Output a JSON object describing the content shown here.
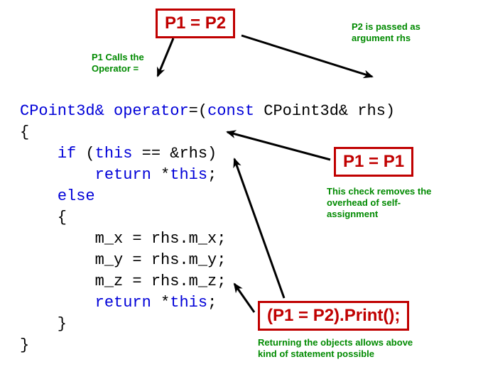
{
  "code": {
    "line1_ret": "CPoint3d&",
    "line1_op": "operator",
    "line1_eq": "=(",
    "line1_const": "const",
    "line1_rest": " CPoint3d& rhs)",
    "line2": "{",
    "line3_a": "    ",
    "line3_if": "if",
    "line3_b": " (",
    "line3_this": "this",
    "line3_c": " == &rhs)",
    "line4_a": "        ",
    "line4_return": "return",
    "line4_b": " *",
    "line4_this": "this",
    "line4_c": ";",
    "line5_a": "    ",
    "line5_else": "else",
    "line6": "    {",
    "line7": "        m_x = rhs.m_x;",
    "line8": "        m_y = rhs.m_y;",
    "line9": "        m_z = rhs.m_z;",
    "line10_a": "        ",
    "line10_return": "return",
    "line10_b": " *",
    "line10_this": "this",
    "line10_c": ";",
    "line11": "    }",
    "line12": "}"
  },
  "callouts": {
    "p1p2": "P1 = P2",
    "p1p1": "P1 = P1",
    "chained": "(P1 = P2).Print();"
  },
  "annotations": {
    "calls_op": "P1 Calls the\nOperator =",
    "passed_as": "P2 is passed as\nargument rhs",
    "self_check": "This check removes the\noverhead of self-\nassignment",
    "returning": "Returning the objects allows above\nkind of statement possible"
  }
}
